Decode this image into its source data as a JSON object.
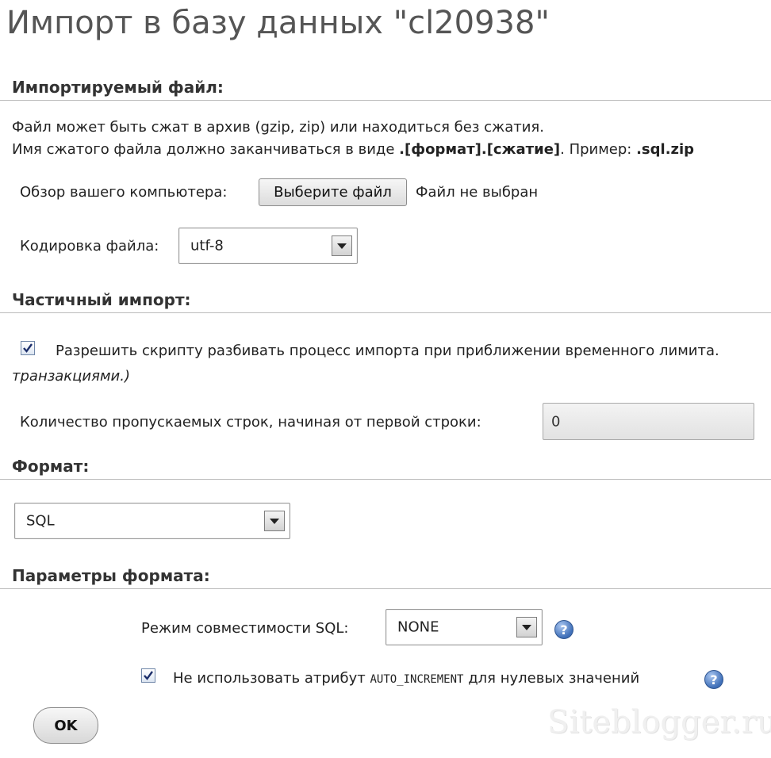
{
  "page": {
    "title": "Импорт в базу данных \"cl20938\""
  },
  "import_file": {
    "heading": "Импортируемый файл:",
    "info_line1": "Файл может быть сжат в архив (gzip, zip) или находиться без сжатия.",
    "info_line2_prefix": "Имя сжатого файла должно заканчиваться в виде ",
    "info_line2_format": ".[формат].[сжатие]",
    "info_line2_middle": ". Пример: ",
    "info_line2_example": ".sql.zip",
    "browse_label": "Обзор вашего компьютера:",
    "choose_button": "Выберите файл",
    "no_file_text": "Файл не выбран",
    "encoding_label": "Кодировка файла:",
    "encoding_value": "utf-8"
  },
  "partial_import": {
    "heading": "Частичный импорт:",
    "allow_interrupt_label": "Разрешить скрипту разбивать процесс импорта при приближении временного лимита.",
    "allow_interrupt_checked": true,
    "cut_text": "транзакциями.)",
    "skip_rows_label": "Количество пропускаемых строк, начиная от первой строки:",
    "skip_rows_value": "0"
  },
  "format": {
    "heading": "Формат:",
    "value": "SQL"
  },
  "format_options": {
    "heading": "Параметры формата:",
    "compat_label": "Режим совместимости SQL:",
    "compat_value": "NONE",
    "no_auto_prefix": "Не использовать атрибут ",
    "no_auto_code": "AUTO_INCREMENT",
    "no_auto_suffix": " для нулевых значений",
    "no_auto_checked": true,
    "help_glyph": "?"
  },
  "actions": {
    "ok_label": "OK"
  },
  "watermark": "Siteblogger.ru"
}
